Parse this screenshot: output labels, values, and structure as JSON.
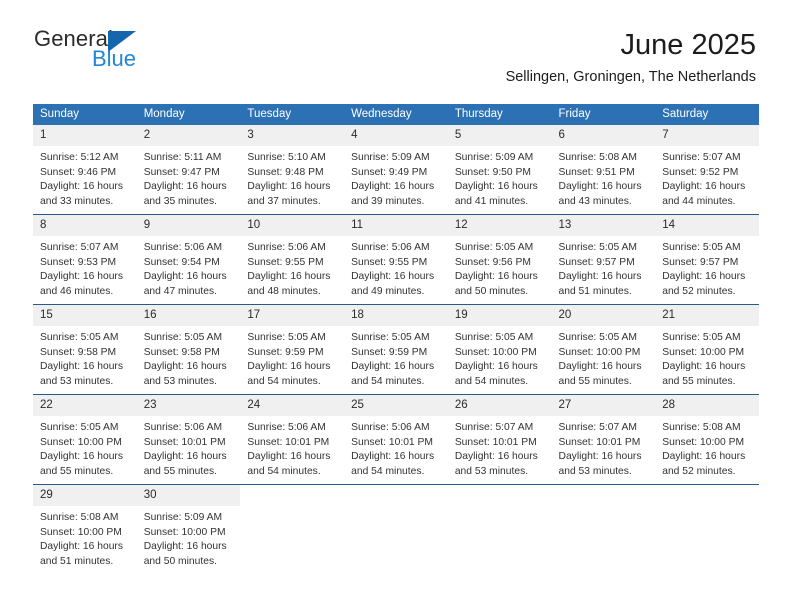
{
  "brand": {
    "name_dark": "General",
    "name_blue": "Blue",
    "accent_blue": "#1f87d8",
    "triangle_blue": "#1566ad"
  },
  "header": {
    "title": "June 2025",
    "subtitle": "Sellingen, Groningen, The Netherlands"
  },
  "theme": {
    "header_bg": "#2d71b5",
    "daynum_bg": "#f0f0f0",
    "row_border": "#27598c"
  },
  "weekday_headers": [
    "Sunday",
    "Monday",
    "Tuesday",
    "Wednesday",
    "Thursday",
    "Friday",
    "Saturday"
  ],
  "weeks": [
    [
      {
        "day": "1",
        "sunrise": "Sunrise: 5:12 AM",
        "sunset": "Sunset: 9:46 PM",
        "daylight1": "Daylight: 16 hours",
        "daylight2": "and 33 minutes."
      },
      {
        "day": "2",
        "sunrise": "Sunrise: 5:11 AM",
        "sunset": "Sunset: 9:47 PM",
        "daylight1": "Daylight: 16 hours",
        "daylight2": "and 35 minutes."
      },
      {
        "day": "3",
        "sunrise": "Sunrise: 5:10 AM",
        "sunset": "Sunset: 9:48 PM",
        "daylight1": "Daylight: 16 hours",
        "daylight2": "and 37 minutes."
      },
      {
        "day": "4",
        "sunrise": "Sunrise: 5:09 AM",
        "sunset": "Sunset: 9:49 PM",
        "daylight1": "Daylight: 16 hours",
        "daylight2": "and 39 minutes."
      },
      {
        "day": "5",
        "sunrise": "Sunrise: 5:09 AM",
        "sunset": "Sunset: 9:50 PM",
        "daylight1": "Daylight: 16 hours",
        "daylight2": "and 41 minutes."
      },
      {
        "day": "6",
        "sunrise": "Sunrise: 5:08 AM",
        "sunset": "Sunset: 9:51 PM",
        "daylight1": "Daylight: 16 hours",
        "daylight2": "and 43 minutes."
      },
      {
        "day": "7",
        "sunrise": "Sunrise: 5:07 AM",
        "sunset": "Sunset: 9:52 PM",
        "daylight1": "Daylight: 16 hours",
        "daylight2": "and 44 minutes."
      }
    ],
    [
      {
        "day": "8",
        "sunrise": "Sunrise: 5:07 AM",
        "sunset": "Sunset: 9:53 PM",
        "daylight1": "Daylight: 16 hours",
        "daylight2": "and 46 minutes."
      },
      {
        "day": "9",
        "sunrise": "Sunrise: 5:06 AM",
        "sunset": "Sunset: 9:54 PM",
        "daylight1": "Daylight: 16 hours",
        "daylight2": "and 47 minutes."
      },
      {
        "day": "10",
        "sunrise": "Sunrise: 5:06 AM",
        "sunset": "Sunset: 9:55 PM",
        "daylight1": "Daylight: 16 hours",
        "daylight2": "and 48 minutes."
      },
      {
        "day": "11",
        "sunrise": "Sunrise: 5:06 AM",
        "sunset": "Sunset: 9:55 PM",
        "daylight1": "Daylight: 16 hours",
        "daylight2": "and 49 minutes."
      },
      {
        "day": "12",
        "sunrise": "Sunrise: 5:05 AM",
        "sunset": "Sunset: 9:56 PM",
        "daylight1": "Daylight: 16 hours",
        "daylight2": "and 50 minutes."
      },
      {
        "day": "13",
        "sunrise": "Sunrise: 5:05 AM",
        "sunset": "Sunset: 9:57 PM",
        "daylight1": "Daylight: 16 hours",
        "daylight2": "and 51 minutes."
      },
      {
        "day": "14",
        "sunrise": "Sunrise: 5:05 AM",
        "sunset": "Sunset: 9:57 PM",
        "daylight1": "Daylight: 16 hours",
        "daylight2": "and 52 minutes."
      }
    ],
    [
      {
        "day": "15",
        "sunrise": "Sunrise: 5:05 AM",
        "sunset": "Sunset: 9:58 PM",
        "daylight1": "Daylight: 16 hours",
        "daylight2": "and 53 minutes."
      },
      {
        "day": "16",
        "sunrise": "Sunrise: 5:05 AM",
        "sunset": "Sunset: 9:58 PM",
        "daylight1": "Daylight: 16 hours",
        "daylight2": "and 53 minutes."
      },
      {
        "day": "17",
        "sunrise": "Sunrise: 5:05 AM",
        "sunset": "Sunset: 9:59 PM",
        "daylight1": "Daylight: 16 hours",
        "daylight2": "and 54 minutes."
      },
      {
        "day": "18",
        "sunrise": "Sunrise: 5:05 AM",
        "sunset": "Sunset: 9:59 PM",
        "daylight1": "Daylight: 16 hours",
        "daylight2": "and 54 minutes."
      },
      {
        "day": "19",
        "sunrise": "Sunrise: 5:05 AM",
        "sunset": "Sunset: 10:00 PM",
        "daylight1": "Daylight: 16 hours",
        "daylight2": "and 54 minutes."
      },
      {
        "day": "20",
        "sunrise": "Sunrise: 5:05 AM",
        "sunset": "Sunset: 10:00 PM",
        "daylight1": "Daylight: 16 hours",
        "daylight2": "and 55 minutes."
      },
      {
        "day": "21",
        "sunrise": "Sunrise: 5:05 AM",
        "sunset": "Sunset: 10:00 PM",
        "daylight1": "Daylight: 16 hours",
        "daylight2": "and 55 minutes."
      }
    ],
    [
      {
        "day": "22",
        "sunrise": "Sunrise: 5:05 AM",
        "sunset": "Sunset: 10:00 PM",
        "daylight1": "Daylight: 16 hours",
        "daylight2": "and 55 minutes."
      },
      {
        "day": "23",
        "sunrise": "Sunrise: 5:06 AM",
        "sunset": "Sunset: 10:01 PM",
        "daylight1": "Daylight: 16 hours",
        "daylight2": "and 55 minutes."
      },
      {
        "day": "24",
        "sunrise": "Sunrise: 5:06 AM",
        "sunset": "Sunset: 10:01 PM",
        "daylight1": "Daylight: 16 hours",
        "daylight2": "and 54 minutes."
      },
      {
        "day": "25",
        "sunrise": "Sunrise: 5:06 AM",
        "sunset": "Sunset: 10:01 PM",
        "daylight1": "Daylight: 16 hours",
        "daylight2": "and 54 minutes."
      },
      {
        "day": "26",
        "sunrise": "Sunrise: 5:07 AM",
        "sunset": "Sunset: 10:01 PM",
        "daylight1": "Daylight: 16 hours",
        "daylight2": "and 53 minutes."
      },
      {
        "day": "27",
        "sunrise": "Sunrise: 5:07 AM",
        "sunset": "Sunset: 10:01 PM",
        "daylight1": "Daylight: 16 hours",
        "daylight2": "and 53 minutes."
      },
      {
        "day": "28",
        "sunrise": "Sunrise: 5:08 AM",
        "sunset": "Sunset: 10:00 PM",
        "daylight1": "Daylight: 16 hours",
        "daylight2": "and 52 minutes."
      }
    ],
    [
      {
        "day": "29",
        "sunrise": "Sunrise: 5:08 AM",
        "sunset": "Sunset: 10:00 PM",
        "daylight1": "Daylight: 16 hours",
        "daylight2": "and 51 minutes."
      },
      {
        "day": "30",
        "sunrise": "Sunrise: 5:09 AM",
        "sunset": "Sunset: 10:00 PM",
        "daylight1": "Daylight: 16 hours",
        "daylight2": "and 50 minutes."
      },
      {
        "day": "",
        "sunrise": "",
        "sunset": "",
        "daylight1": "",
        "daylight2": ""
      },
      {
        "day": "",
        "sunrise": "",
        "sunset": "",
        "daylight1": "",
        "daylight2": ""
      },
      {
        "day": "",
        "sunrise": "",
        "sunset": "",
        "daylight1": "",
        "daylight2": ""
      },
      {
        "day": "",
        "sunrise": "",
        "sunset": "",
        "daylight1": "",
        "daylight2": ""
      },
      {
        "day": "",
        "sunrise": "",
        "sunset": "",
        "daylight1": "",
        "daylight2": ""
      }
    ]
  ]
}
